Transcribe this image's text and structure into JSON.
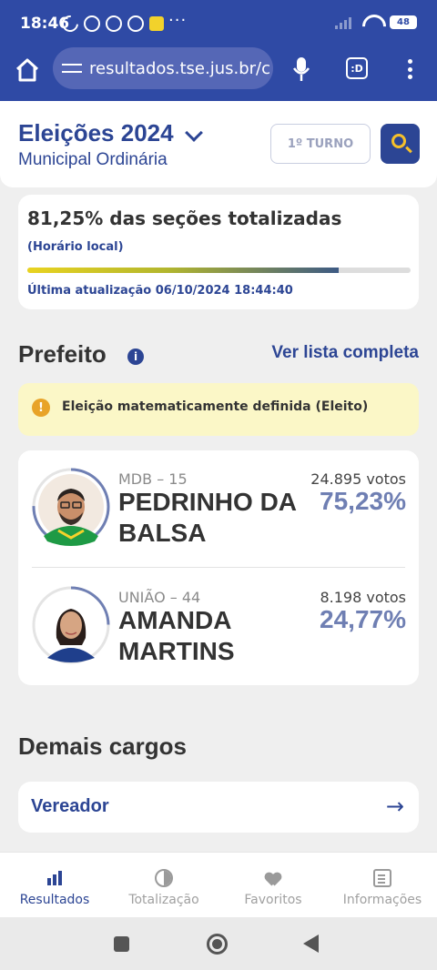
{
  "status": {
    "time": "18:46",
    "battery": "48"
  },
  "browser": {
    "url": "resultados.tse.jus.br/c",
    "tabs_label": ":D"
  },
  "header": {
    "title": "Eleições 2024",
    "subtitle": "Municipal Ordinária",
    "turno": "1º TURNO"
  },
  "progress": {
    "percent_text": "81,25% das seções totalizadas",
    "percent": 81.25,
    "local_time": "(Horário local)",
    "last_update": "Última atualização 06/10/2024 18:44:40"
  },
  "prefeito": {
    "title": "Prefeito",
    "info": "i",
    "see_all": "Ver lista completa",
    "alert_icon": "!",
    "alert": "Eleição matematicamente definida (Eleito)",
    "candidates": [
      {
        "party": "MDB – 15",
        "name_line1": "PEDRINHO DA",
        "name_line2": "BALSA",
        "votes": "24.895 votos",
        "percent": "75,23%",
        "share": 0.7523,
        "ring_color": "#6f7fb3"
      },
      {
        "party": "UNIÃO – 44",
        "name_line1": "AMANDA",
        "name_line2": "MARTINS",
        "votes": "8.198 votos",
        "percent": "24,77%",
        "share": 0.2477,
        "ring_color": "#6f7fb3"
      }
    ]
  },
  "demais": {
    "title": "Demais cargos",
    "vereador": "Vereador",
    "arrow": "→"
  },
  "bottom_nav": [
    {
      "label": "Resultados",
      "icon": "bar-chart-icon",
      "active": true
    },
    {
      "label": "Totalização",
      "icon": "pie-chart-icon",
      "active": false
    },
    {
      "label": "Favoritos",
      "icon": "heart-icon",
      "active": false
    },
    {
      "label": "Informações",
      "icon": "clipboard-icon",
      "active": false
    }
  ],
  "colors": {
    "brand": "#2f4aa5",
    "accent": "#f6c02b",
    "alert_bg": "#fbf7c7"
  }
}
